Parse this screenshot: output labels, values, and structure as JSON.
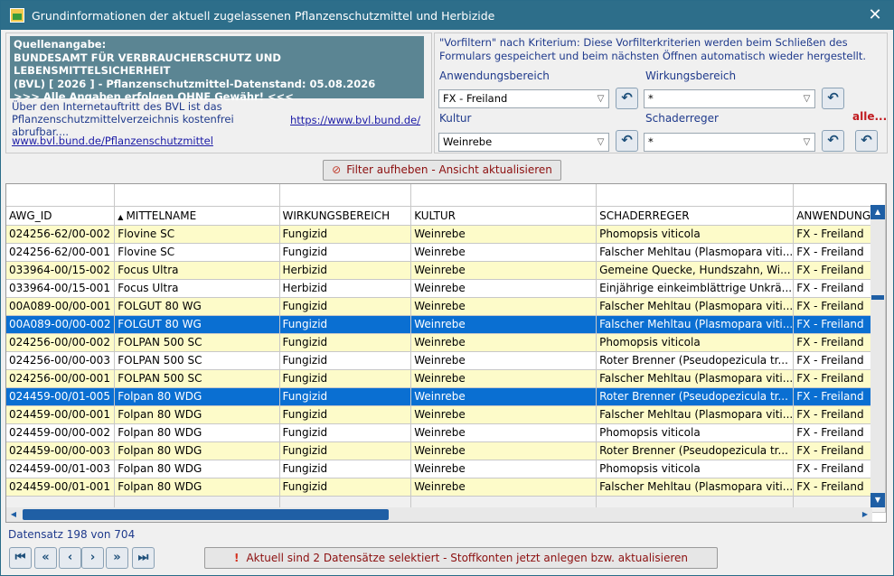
{
  "window": {
    "title": "Grundinformationen der aktuell zugelassenen Pflanzenschutzmittel und Herbizide"
  },
  "source": {
    "lines": [
      "Quellenangabe:",
      "BUNDESAMT FÜR VERBRAUCHERSCHUTZ UND LEBENSMITTELSICHERHEIT",
      "(BVL) [ 2026 ] - Pflanzenschutzmittel-Datenstand: 05.08.2026",
      ">>> Alle Angaben erfolgen OHNE Gewähr! <<<"
    ],
    "about_line1": "Über den Internetauftritt des BVL ist das",
    "about_line2": "Pflanzenschutzmittelverzeichnis kostenfrei abrufbar....",
    "link_main": "https://www.bvl.bund.de/",
    "link_psm": "www.bvl.bund.de/Pflanzenschutzmittel"
  },
  "filter": {
    "note_line1": "\"Vorfiltern\" nach Kriterium: Diese Vorfilterkriterien werden beim Schließen des",
    "note_line2": "Formulars gespeichert und beim nächsten Öffnen automatisch wieder hergestellt.",
    "anwendungsbereich_label": "Anwendungsbereich",
    "anwendungsbereich_value": "FX - Freiland",
    "wirkungsbereich_label": "Wirkungsbereich",
    "wirkungsbereich_value": "*",
    "kultur_label": "Kultur",
    "kultur_value": "Weinrebe",
    "schaderreger_label": "Schaderreger",
    "schaderreger_value": "*",
    "alle_label": "alle...",
    "clear_button": "Filter aufheben - Ansicht aktualisieren"
  },
  "grid": {
    "columns": [
      "AWG_ID",
      "MITTELNAME",
      "WIRKUNGSBEREICH",
      "KULTUR",
      "SCHADERREGER",
      "ANWENDUNGSB"
    ],
    "sorted_column": 1,
    "rows": [
      [
        "024256-62/00-002",
        "Flovine SC",
        "Fungizid",
        "Weinrebe",
        "Phomopsis viticola",
        "FX - Freiland",
        "odd"
      ],
      [
        "024256-62/00-001",
        "Flovine SC",
        "Fungizid",
        "Weinrebe",
        "Falscher Mehltau (Plasmopara viti...",
        "FX - Freiland",
        "even"
      ],
      [
        "033964-00/15-002",
        "Focus Ultra",
        "Herbizid",
        "Weinrebe",
        "Gemeine Quecke, Hundszahn, Wi...",
        "FX - Freiland",
        "odd"
      ],
      [
        "033964-00/15-001",
        "Focus Ultra",
        "Herbizid",
        "Weinrebe",
        "Einjährige einkeimblättrige Unkrä...",
        "FX - Freiland",
        "even"
      ],
      [
        "00A089-00/00-001",
        "FOLGUT 80 WG",
        "Fungizid",
        "Weinrebe",
        "Falscher Mehltau (Plasmopara viti...",
        "FX - Freiland",
        "odd"
      ],
      [
        "00A089-00/00-002",
        "FOLGUT 80 WG",
        "Fungizid",
        "Weinrebe",
        "Falscher Mehltau (Plasmopara viti...",
        "FX - Freiland",
        "sel"
      ],
      [
        "024256-00/00-002",
        "FOLPAN 500 SC",
        "Fungizid",
        "Weinrebe",
        "Phomopsis viticola",
        "FX - Freiland",
        "odd"
      ],
      [
        "024256-00/00-003",
        "FOLPAN 500 SC",
        "Fungizid",
        "Weinrebe",
        "Roter Brenner (Pseudopezicula tr...",
        "FX - Freiland",
        "even"
      ],
      [
        "024256-00/00-001",
        "FOLPAN 500 SC",
        "Fungizid",
        "Weinrebe",
        "Falscher Mehltau (Plasmopara viti...",
        "FX - Freiland",
        "odd"
      ],
      [
        "024459-00/01-005",
        "Folpan 80 WDG",
        "Fungizid",
        "Weinrebe",
        "Roter Brenner (Pseudopezicula tr...",
        "FX - Freiland",
        "sel"
      ],
      [
        "024459-00/00-001",
        "Folpan 80 WDG",
        "Fungizid",
        "Weinrebe",
        "Falscher Mehltau (Plasmopara viti...",
        "FX - Freiland",
        "odd"
      ],
      [
        "024459-00/00-002",
        "Folpan 80 WDG",
        "Fungizid",
        "Weinrebe",
        "Phomopsis viticola",
        "FX - Freiland",
        "even"
      ],
      [
        "024459-00/00-003",
        "Folpan 80 WDG",
        "Fungizid",
        "Weinrebe",
        "Roter Brenner (Pseudopezicula tr...",
        "FX - Freiland",
        "odd"
      ],
      [
        "024459-00/01-003",
        "Folpan 80 WDG",
        "Fungizid",
        "Weinrebe",
        "Phomopsis viticola",
        "FX - Freiland",
        "even"
      ],
      [
        "024459-00/01-001",
        "Folpan 80 WDG",
        "Fungizid",
        "Weinrebe",
        "Falscher Mehltau (Plasmopara viti...",
        "FX - Freiland",
        "odd"
      ]
    ]
  },
  "status": {
    "record": "Datensatz 198 von 704"
  },
  "nav": {
    "first": "⏮",
    "prev_page": "«",
    "prev": "‹",
    "next": "›",
    "next_page": "»",
    "last": "⏭"
  },
  "action": {
    "stoffkonten_button": "Aktuell sind 2 Datensätze selektiert - Stoffkonten jetzt anlegen bzw. aktualisieren"
  }
}
